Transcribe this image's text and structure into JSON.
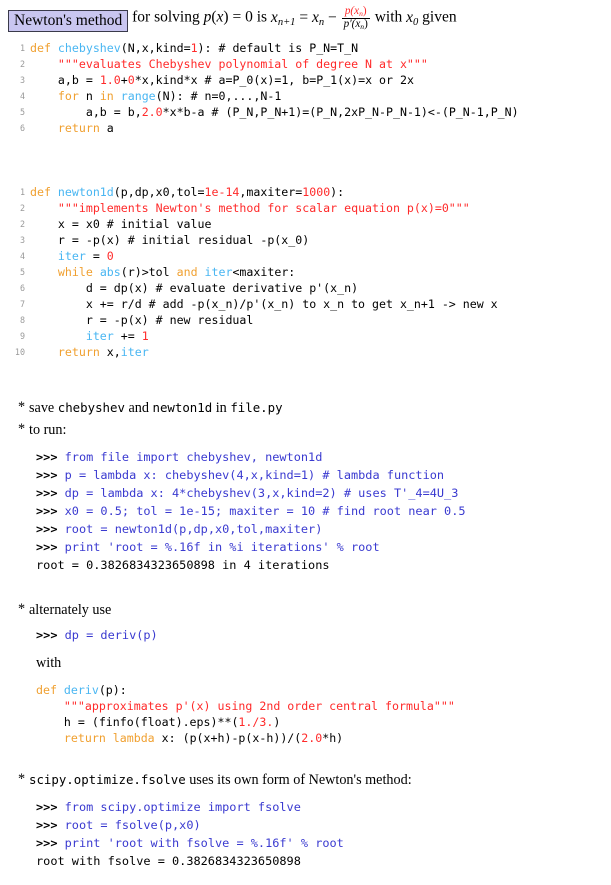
{
  "headline": {
    "title_box": "Newton's method",
    "text_before": "for solving",
    "eq_px": "p(x) = 0",
    "text_is": "is",
    "eq_iter_lhs": "x",
    "eq_iter_lhs_sub": "n+1",
    "eq_equals": "=",
    "eq_xn": "x",
    "eq_xn_sub": "n",
    "eq_minus": "−",
    "frac_num": "p(x",
    "frac_num_sub": "n",
    "frac_num_end": ")",
    "frac_den": "p′(x",
    "frac_den_sub": "n",
    "frac_den_end": ")",
    "text_with": "with",
    "eq_x0": "x",
    "eq_x0_sub": "0",
    "text_given": "given"
  },
  "listing_chebyshev": {
    "lines": [
      {
        "no": "1",
        "tokens": [
          {
            "t": "def ",
            "c": "kw"
          },
          {
            "t": "chebyshev",
            "c": "fn"
          },
          {
            "t": "(N,x,kind=",
            "c": "pln"
          },
          {
            "t": "1",
            "c": "num"
          },
          {
            "t": "): # default is P_N=T_N",
            "c": "pln"
          }
        ]
      },
      {
        "no": "2",
        "tokens": [
          {
            "t": "    ",
            "c": "pln"
          },
          {
            "t": "\"\"\"evaluates Chebyshev polynomial of degree N at x\"\"\"",
            "c": "str"
          }
        ]
      },
      {
        "no": "3",
        "tokens": [
          {
            "t": "    a,b = ",
            "c": "pln"
          },
          {
            "t": "1.0",
            "c": "num"
          },
          {
            "t": "+",
            "c": "pln"
          },
          {
            "t": "0",
            "c": "num"
          },
          {
            "t": "*x,kind*x # a=P_0(x)=1, b=P_1(x)=x or 2x",
            "c": "pln"
          }
        ]
      },
      {
        "no": "4",
        "tokens": [
          {
            "t": "    ",
            "c": "pln"
          },
          {
            "t": "for ",
            "c": "kw"
          },
          {
            "t": "n ",
            "c": "pln"
          },
          {
            "t": "in ",
            "c": "kw"
          },
          {
            "t": "range",
            "c": "fn"
          },
          {
            "t": "(N): # n=0,...,N-1",
            "c": "pln"
          }
        ]
      },
      {
        "no": "5",
        "tokens": [
          {
            "t": "        a,b = b,",
            "c": "pln"
          },
          {
            "t": "2.0",
            "c": "num"
          },
          {
            "t": "*x*b-a # (P_N,P_N+1)=(P_N,2xP_N-P_N-1)<-(P_N-1,P_N)",
            "c": "pln"
          }
        ]
      },
      {
        "no": "6",
        "tokens": [
          {
            "t": "    ",
            "c": "pln"
          },
          {
            "t": "return ",
            "c": "kw"
          },
          {
            "t": "a",
            "c": "pln"
          }
        ]
      }
    ]
  },
  "listing_newton1d": {
    "lines": [
      {
        "no": "1",
        "tokens": [
          {
            "t": "def ",
            "c": "kw"
          },
          {
            "t": "newton1d",
            "c": "fn"
          },
          {
            "t": "(p,dp,x0,tol=",
            "c": "pln"
          },
          {
            "t": "1e-14",
            "c": "num"
          },
          {
            "t": ",maxiter=",
            "c": "pln"
          },
          {
            "t": "1000",
            "c": "num"
          },
          {
            "t": "):",
            "c": "pln"
          }
        ]
      },
      {
        "no": "2",
        "tokens": [
          {
            "t": "    ",
            "c": "pln"
          },
          {
            "t": "\"\"\"implements Newton's method for scalar equation p(x)=0\"\"\"",
            "c": "str"
          }
        ]
      },
      {
        "no": "2",
        "tokens": [
          {
            "t": "    x = x0 # initial value",
            "c": "pln"
          }
        ]
      },
      {
        "no": "3",
        "tokens": [
          {
            "t": "    r = -p(x) # initial residual -p(x_0)",
            "c": "pln"
          }
        ]
      },
      {
        "no": "4",
        "tokens": [
          {
            "t": "    ",
            "c": "pln"
          },
          {
            "t": "iter",
            "c": "fn"
          },
          {
            "t": " = ",
            "c": "pln"
          },
          {
            "t": "0",
            "c": "num"
          }
        ]
      },
      {
        "no": "5",
        "tokens": [
          {
            "t": "    ",
            "c": "pln"
          },
          {
            "t": "while ",
            "c": "kw"
          },
          {
            "t": "abs",
            "c": "fn"
          },
          {
            "t": "(r)>tol ",
            "c": "pln"
          },
          {
            "t": "and ",
            "c": "kw"
          },
          {
            "t": "iter",
            "c": "fn"
          },
          {
            "t": "<maxiter:",
            "c": "pln"
          }
        ]
      },
      {
        "no": "6",
        "tokens": [
          {
            "t": "        d = dp(x) # evaluate derivative p'(x_n)",
            "c": "pln"
          }
        ]
      },
      {
        "no": "7",
        "tokens": [
          {
            "t": "        x += r/d # add -p(x_n)/p'(x_n) to x_n to get x_n+1 -> new x",
            "c": "pln"
          }
        ]
      },
      {
        "no": "8",
        "tokens": [
          {
            "t": "        r = -p(x) # new residual",
            "c": "pln"
          }
        ]
      },
      {
        "no": "9",
        "tokens": [
          {
            "t": "        ",
            "c": "pln"
          },
          {
            "t": "iter",
            "c": "fn"
          },
          {
            "t": " += ",
            "c": "pln"
          },
          {
            "t": "1",
            "c": "num"
          }
        ]
      },
      {
        "no": "10",
        "tokens": [
          {
            "t": "    ",
            "c": "pln"
          },
          {
            "t": "return ",
            "c": "kw"
          },
          {
            "t": "x,",
            "c": "pln"
          },
          {
            "t": "iter",
            "c": "fn"
          }
        ]
      }
    ]
  },
  "listing_deriv": {
    "lines": [
      {
        "no": "",
        "tokens": [
          {
            "t": "def ",
            "c": "kw"
          },
          {
            "t": "deriv",
            "c": "fn"
          },
          {
            "t": "(p):",
            "c": "pln"
          }
        ]
      },
      {
        "no": "",
        "tokens": [
          {
            "t": "    ",
            "c": "pln"
          },
          {
            "t": "\"\"\"approximates p'(x) using 2nd order central formula\"\"\"",
            "c": "str"
          }
        ]
      },
      {
        "no": "",
        "tokens": [
          {
            "t": "    h = (finfo(float).eps)**(",
            "c": "pln"
          },
          {
            "t": "1./3.",
            "c": "num"
          },
          {
            "t": ")",
            "c": "pln"
          }
        ]
      },
      {
        "no": "",
        "tokens": [
          {
            "t": "    ",
            "c": "pln"
          },
          {
            "t": "return lambda ",
            "c": "kw"
          },
          {
            "t": "x: (p(x+h)-p(x-h))/(",
            "c": "pln"
          },
          {
            "t": "2.0",
            "c": "num"
          },
          {
            "t": "*h)",
            "c": "pln"
          }
        ]
      }
    ]
  },
  "bullets": {
    "save": {
      "star": "*",
      "part1": "save",
      "code1": "chebyshev",
      "part2": "and",
      "code2": "newton1d",
      "part3": "in",
      "code3": "file.py"
    },
    "to_run": {
      "star": "*",
      "text": "to run:"
    },
    "alternately": {
      "star": "*",
      "text": "alternately use"
    },
    "with_label": "with",
    "fsolve": {
      "star": "*",
      "code": "scipy.optimize.fsolve",
      "text": "uses its own form of Newton's method:"
    }
  },
  "repl_main": {
    "lines": [
      {
        "prompt": ">>> ",
        "code": "from file import chebyshev, newton1d",
        "kind": "in"
      },
      {
        "prompt": ">>> ",
        "code": "p = lambda x: chebyshev(4,x,kind=1) # lambda function",
        "kind": "in"
      },
      {
        "prompt": ">>> ",
        "code": "dp = lambda x: 4*chebyshev(3,x,kind=2) # uses T'_4=4U_3",
        "kind": "in"
      },
      {
        "prompt": ">>> ",
        "code": "x0 = 0.5; tol = 1e-15; maxiter = 10 # find root near 0.5",
        "kind": "in"
      },
      {
        "prompt": ">>> ",
        "code": "root = newton1d(p,dp,x0,tol,maxiter)",
        "kind": "in"
      },
      {
        "prompt": ">>> ",
        "code": "print 'root = %.16f in %i iterations' % root",
        "kind": "in"
      },
      {
        "prompt": "",
        "code": "root = 0.3826834323650898 in 4 iterations",
        "kind": "out"
      }
    ]
  },
  "repl_deriv": {
    "lines": [
      {
        "prompt": ">>> ",
        "code": "dp = deriv(p)",
        "kind": "in"
      }
    ]
  },
  "repl_fsolve": {
    "lines": [
      {
        "prompt": ">>> ",
        "code": "from scipy.optimize import fsolve",
        "kind": "in"
      },
      {
        "prompt": ">>> ",
        "code": "root = fsolve(p,x0)",
        "kind": "in"
      },
      {
        "prompt": ">>> ",
        "code": "print 'root with fsolve = %.16f' % root",
        "kind": "in"
      },
      {
        "prompt": "",
        "code": "root with fsolve = 0.3826834323650898",
        "kind": "out"
      }
    ]
  },
  "colors": {
    "title_box_fill": "#c9c6f0",
    "title_box_border": "#3a3a4a",
    "keyword": "#f0a030",
    "function": "#49b6f2",
    "string": "#ff2a2a",
    "number": "#ff2a2a",
    "repl_code": "#3a3ad0",
    "line_number": "#9a9a9a"
  }
}
